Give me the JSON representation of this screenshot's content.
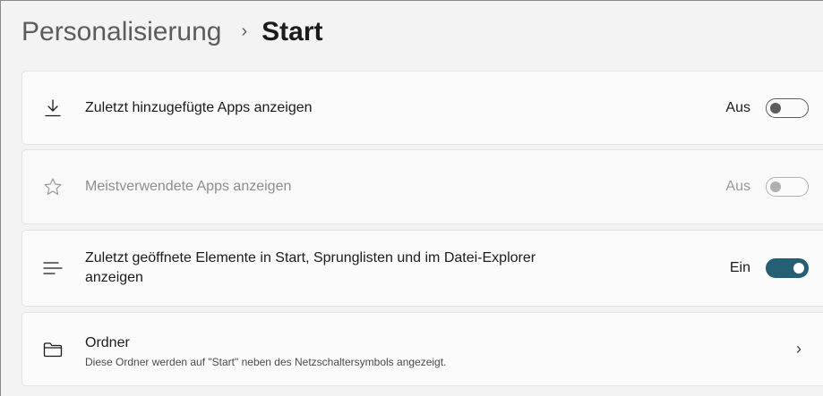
{
  "breadcrumb": {
    "parent": "Personalisierung",
    "separator": "›",
    "current": "Start"
  },
  "settings": [
    {
      "icon": "download-icon",
      "label": "Zuletzt hinzugefügte Apps anzeigen",
      "state_label": "Aus",
      "state": "off",
      "enabled": true
    },
    {
      "icon": "star-icon",
      "label": "Meistverwendete Apps anzeigen",
      "state_label": "Aus",
      "state": "off",
      "enabled": false
    },
    {
      "icon": "list-icon",
      "label_line1": "Zuletzt geöffnete Elemente in Start, Sprunglisten und im Datei-Explorer",
      "label_line2": "anzeigen",
      "state_label": "Ein",
      "state": "on",
      "enabled": true
    },
    {
      "icon": "folder-icon",
      "label": "Ordner",
      "sublabel": "Diese Ordner werden auf \"Start\" neben des Netzschaltersymbols angezeigt.",
      "chevron": "›"
    }
  ],
  "colors": {
    "accent": "#245f74",
    "background": "#f3f3f3",
    "card": "#fbfbfb"
  }
}
